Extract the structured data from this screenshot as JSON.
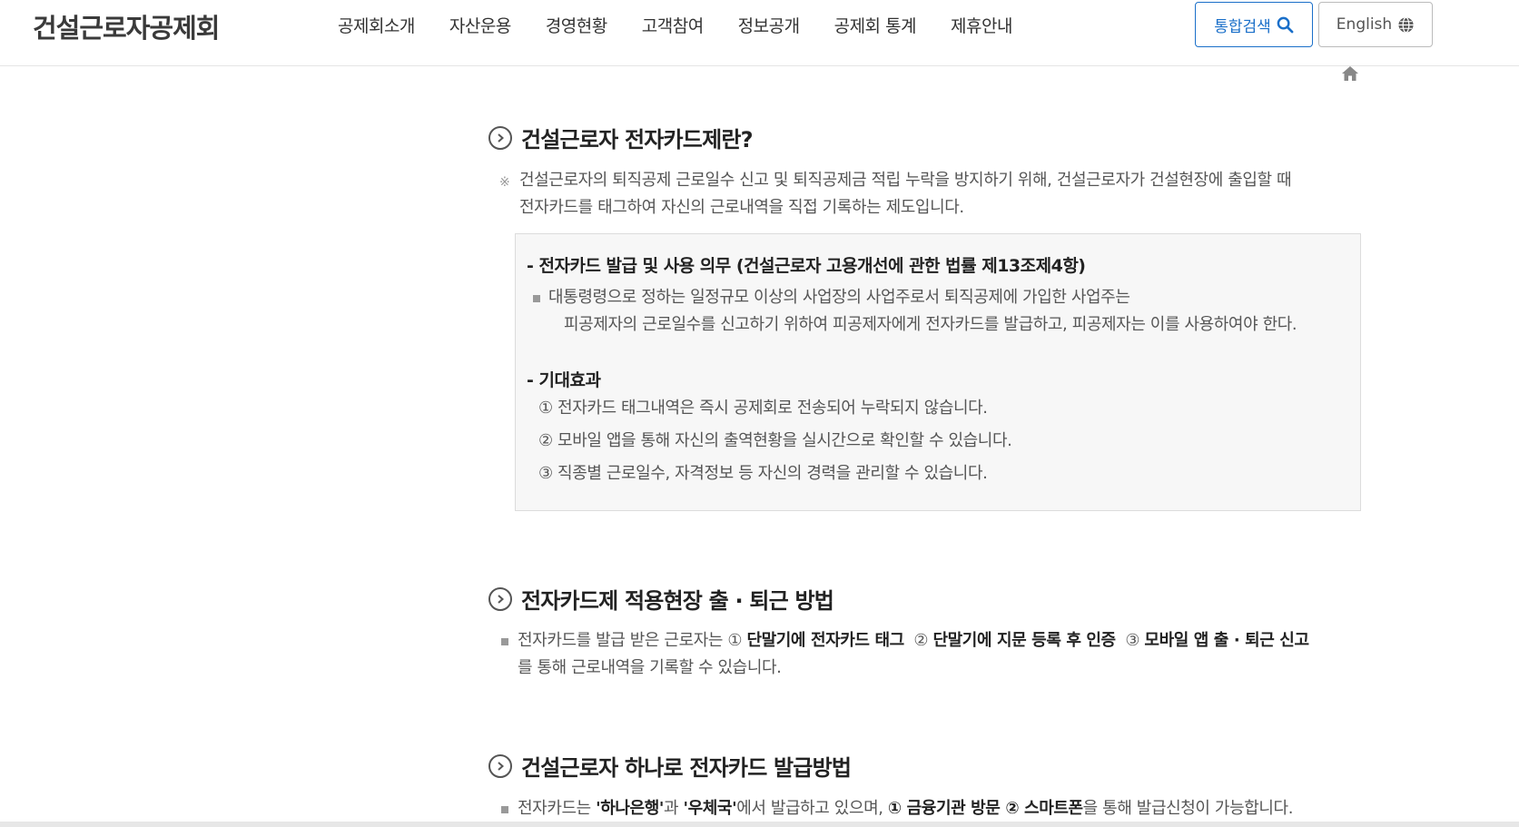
{
  "header": {
    "logo": "건설근로자공제회",
    "nav": [
      "공제회소개",
      "자산운용",
      "경영현황",
      "고객참여",
      "정보공개",
      "공제회 통계",
      "제휴안내"
    ],
    "search_label": "통합검색",
    "lang_label": "English"
  },
  "section1": {
    "title": "건설근로자 전자카드제란?",
    "note_mark": "※",
    "note_line1": "건설근로자의 퇴직공제 근로일수 신고 및 퇴직공제금 적립 누락을 방지하기 위해, 건설근로자가 건설현장에 출입할 때",
    "note_line2": "전자카드를 태그하여 자신의 근로내역을 직접 기록하는 제도입니다.",
    "box": {
      "heading1": "- 전자카드 발급 및 사용 의무 (건설근로자 고용개선에 관한 법률 제13조제4항)",
      "law_line1": "대통령령으로 정하는 일정규모 이상의 사업장의 사업주로서 퇴직공제에 가입한 사업주는",
      "law_line2": "피공제자의 근로일수를 신고하기 위하여 피공제자에게 전자카드를 발급하고, 피공제자는 이를 사용하여야 한다.",
      "heading2": "- 기대효과",
      "effects": [
        "① 전자카드 태그내역은 즉시 공제회로 전송되어 누락되지 않습니다.",
        "② 모바일 앱을 통해 자신의 출역현황을 실시간으로 확인할 수 있습니다.",
        "③ 직종별 근로일수, 자격정보 등 자신의 경력을 관리할 수 있습니다."
      ]
    }
  },
  "section2": {
    "title": "전자카드제 적용현장 출 · 퇴근 방법",
    "lead": "전자카드를 발급 받은 근로자는 ",
    "m1": "① ",
    "b1": "단말기에 전자카드 태그",
    "m2": "  ② ",
    "b2": "단말기에 지문 등록 후 인증",
    "m3": "  ③ ",
    "b3": "모바일 앱 출 · 퇴근 신고",
    "line2": "를 통해 근로내역을 기록할 수 있습니다."
  },
  "section3": {
    "title": "건설근로자 하나로 전자카드 발급방법",
    "t1": "전자카드는 ",
    "b1": "'하나은행'",
    "t2": "과 ",
    "b2": "'우체국'",
    "t3": "에서 발급하고 있으며, ",
    "b3": "① 금융기관 방문 ② 스마트폰",
    "t4": "을 통해 발급신청이 가능합니다."
  }
}
